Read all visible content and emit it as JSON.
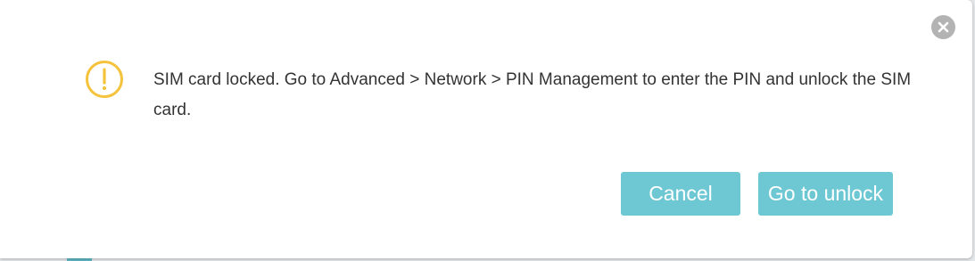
{
  "dialog": {
    "message": "SIM card locked. Go to Advanced > Network > PIN Management to enter the PIN and unlock the SIM card.",
    "close_icon": "close-icon",
    "warning_icon": "warning-icon",
    "cancel_label": "Cancel",
    "unlock_label": "Go to unlock"
  },
  "colors": {
    "accent": "#6ec8d4",
    "warning": "#f5c33b",
    "close": "#b3b3b3",
    "text": "#333333"
  }
}
